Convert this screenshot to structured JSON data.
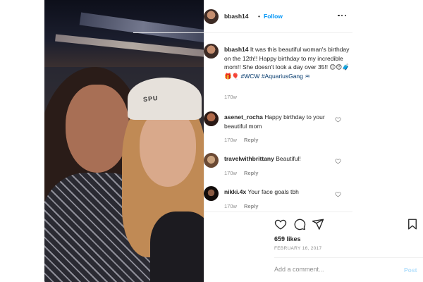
{
  "post": {
    "username": "bbash14",
    "follow_label": "Follow",
    "separator": "•"
  },
  "photo": {
    "beanie_text": "SPU"
  },
  "caption": {
    "username": "bbash14",
    "text": "It was this beautiful woman's birthday on the 12th!! Happy birthday to my incredible mom!! She doesn't look a day over 35!! 😊😍🧳🎁🎈",
    "tags": "#WCW #AquariusGang ♒",
    "time": "170w"
  },
  "comments": [
    {
      "username": "asenet_rocha",
      "text": "Happy birthday to your beautiful mom",
      "time": "170w",
      "reply_label": "Reply"
    },
    {
      "username": "travelwithbrittany",
      "text": "Beautiful!",
      "time": "170w",
      "reply_label": "Reply"
    },
    {
      "username": "nikki.4x",
      "text": "Your face goals tbh",
      "time": "170w",
      "reply_label": "Reply"
    }
  ],
  "likes_text": "659 likes",
  "date_text": "FEBRUARY 16, 2017",
  "add_comment": {
    "placeholder": "Add a comment...",
    "post_label": "Post"
  },
  "icons": {
    "more": "more-options-icon",
    "like": "heart-icon",
    "comment": "comment-icon",
    "share": "paper-plane-icon",
    "save": "bookmark-icon"
  },
  "colors": {
    "follow_blue": "#0095f6",
    "post_button_disabled": "#b2dffc",
    "tag_color": "#00376b",
    "muted_text": "#8e8e8e"
  }
}
